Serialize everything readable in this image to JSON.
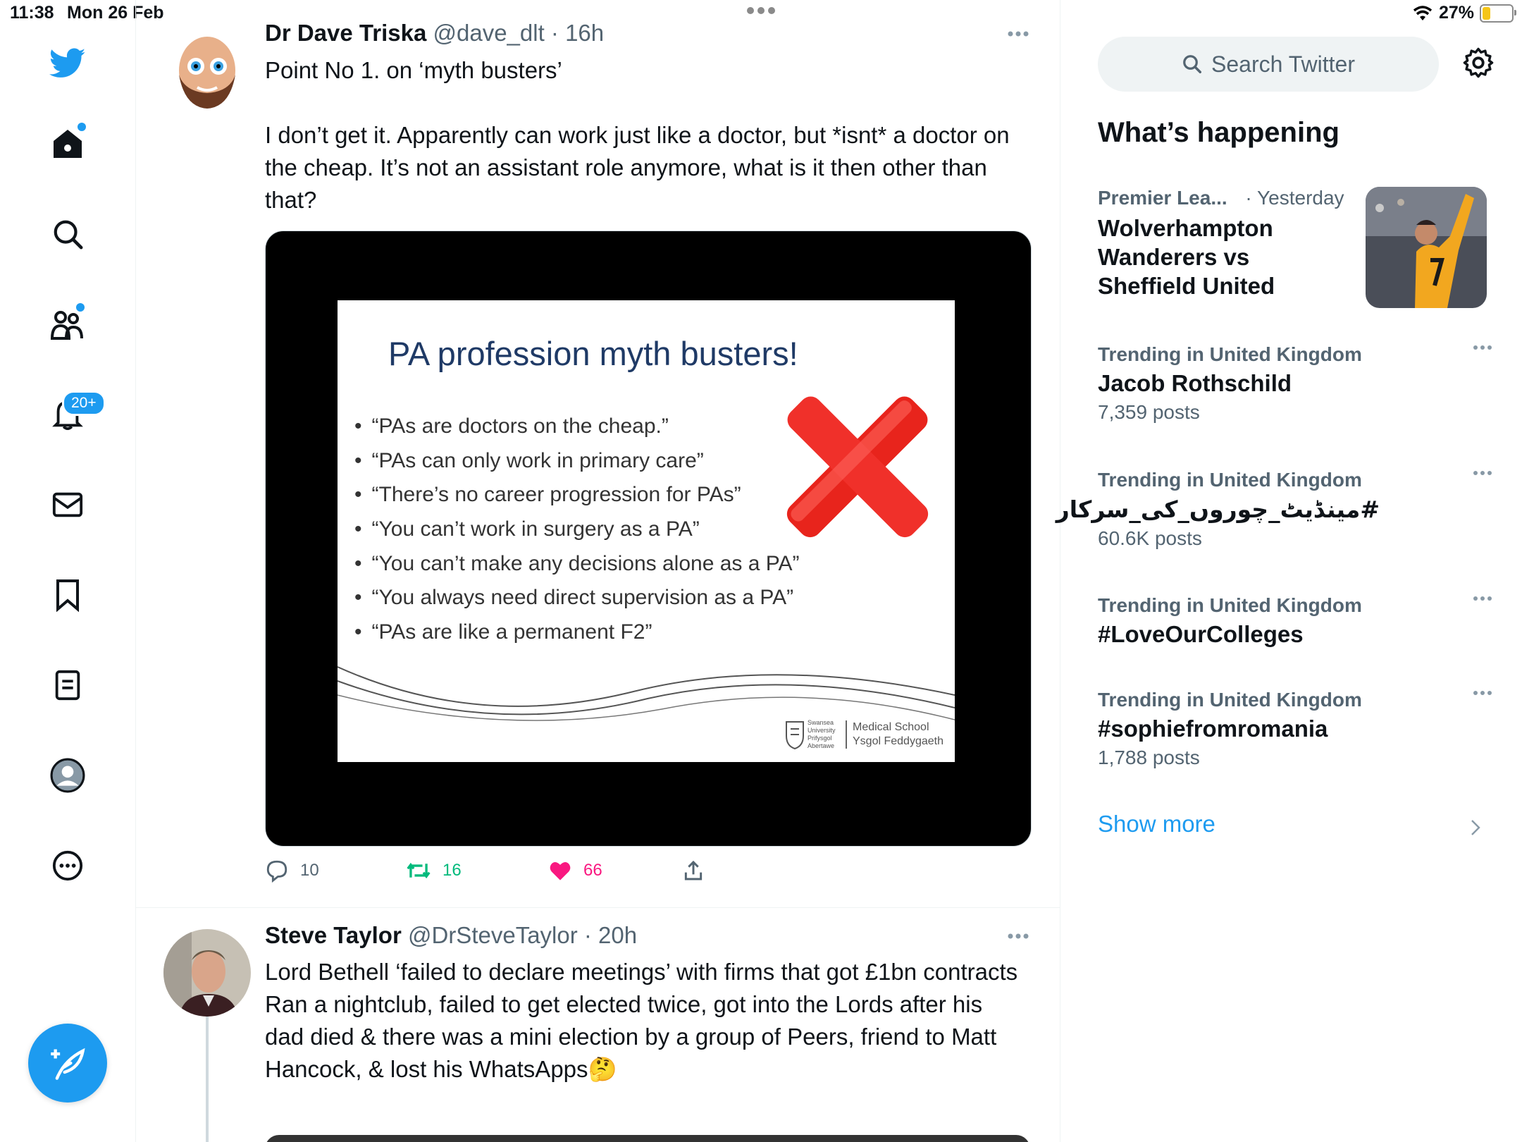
{
  "status_bar": {
    "time": "11:38",
    "date": "Mon 26 Feb",
    "battery": "27%"
  },
  "nav": {
    "items": [
      {
        "id": "home",
        "icon": "home-icon"
      },
      {
        "id": "explore",
        "icon": "search-icon"
      },
      {
        "id": "communities",
        "icon": "communities-icon"
      },
      {
        "id": "notifications",
        "icon": "bell-icon"
      },
      {
        "id": "messages",
        "icon": "envelope-icon"
      },
      {
        "id": "bookmarks",
        "icon": "bookmark-icon"
      },
      {
        "id": "lists",
        "icon": "list-icon"
      },
      {
        "id": "profile",
        "icon": "avatar-icon"
      },
      {
        "id": "more",
        "icon": "more-circle-icon"
      }
    ],
    "notifications_badge": "20+",
    "compose_icon": "compose-quill-icon"
  },
  "feed": {
    "tweets": [
      {
        "name": "Dr Dave Triska",
        "handle": "@dave_dlt",
        "time": "16h",
        "text": "Point No 1. on ‘myth busters’\n\nI don’t get it. Apparently can work just like a doctor, but *isnt* a doctor on the cheap. It’s not an assistant role anymore, what is it then other than that?",
        "media": {
          "slide_title": "PA profession myth busters!",
          "bullets": [
            "“PAs are doctors on the cheap.”",
            "“PAs can only work in primary care”",
            "“There’s no career progression for PAs”",
            "“You can’t work in surgery as a PA”",
            "“You can’t make any decisions alone as a PA”",
            "“You always need direct supervision as a PA”",
            "“PAs are like a permanent F2”"
          ],
          "logo_uni": "Swansea University Prifysgol Abertawe",
          "logo_school_1": "Medical School",
          "logo_school_2": "Ysgol Feddygaeth"
        },
        "replies": "10",
        "retweets": "16",
        "likes": "66"
      },
      {
        "name": "Steve Taylor",
        "handle": "@DrSteveTaylor",
        "time": "20h",
        "text": "Lord Bethell ‘failed to declare meetings’ with firms that got £1bn contracts\nRan a nightclub, failed to get elected twice, got into the Lords after his dad died & there was a mini election by a group of Peers, friend to Matt Hancock, & lost his WhatsApps🤔"
      }
    ]
  },
  "sidebar": {
    "search_placeholder": "Search Twitter",
    "title": "What’s happening",
    "trends": [
      {
        "category": "Premier Lea...",
        "time": "Yesterday",
        "name": "Wolverhampton Wanderers vs Sheffield United"
      },
      {
        "category": "Trending in United Kingdom",
        "name": "Jacob Rothschild",
        "count": "7,359 posts"
      },
      {
        "category": "Trending in United Kingdom",
        "name": "#مینڈیٹ_چوروں_کی_سرکار",
        "count": "60.6K posts"
      },
      {
        "category": "Trending in United Kingdom",
        "name": "#LoveOurColleges"
      },
      {
        "category": "Trending in United Kingdom",
        "name": "#sophiefromromania",
        "count": "1,788 posts"
      }
    ],
    "show_more": "Show more"
  },
  "colors": {
    "accent": "#1d9bf0",
    "retweet": "#00ba7c",
    "like": "#f91880",
    "text": "#0f1419",
    "muted": "#536471"
  }
}
